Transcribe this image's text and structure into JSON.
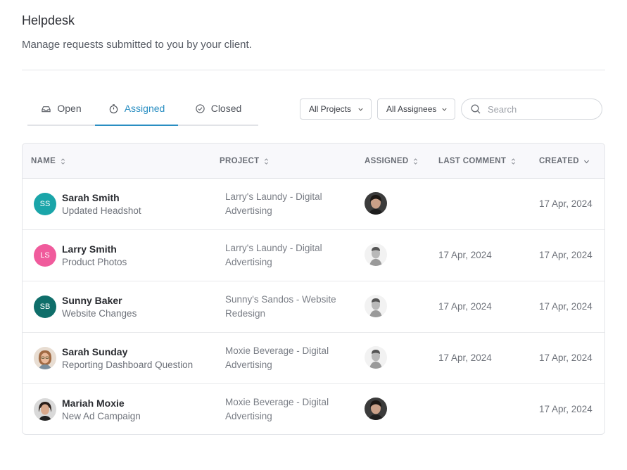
{
  "header": {
    "title": "Helpdesk",
    "subtitle": "Manage requests submitted to you by your client."
  },
  "tabs": [
    {
      "label": "Open",
      "icon": "inbox-icon",
      "active": false
    },
    {
      "label": "Assigned",
      "icon": "timer-icon",
      "active": true
    },
    {
      "label": "Closed",
      "icon": "check-circle-icon",
      "active": false
    }
  ],
  "filters": {
    "projects": "All Projects",
    "assignees": "All Assignees",
    "search_placeholder": "Search"
  },
  "columns": {
    "name": "NAME",
    "project": "PROJECT",
    "assigned": "ASSIGNED",
    "last_comment": "LAST COMMENT",
    "created": "CREATED"
  },
  "colors": {
    "accent": "#2a8ec2",
    "avatar_ss": "#1aa5a9",
    "avatar_ls": "#f05b9c",
    "avatar_sb": "#0f6e6a"
  },
  "rows": [
    {
      "initials": "SS",
      "name": "Sarah Smith",
      "request": "Updated Headshot",
      "project_line1": "Larry's Laundy - Digital",
      "project_line2": "Advertising",
      "assignee": "woman-avatar",
      "last_comment": "",
      "created": "17 Apr, 2024"
    },
    {
      "initials": "LS",
      "name": "Larry Smith",
      "request": "Product Photos",
      "project_line1": "Larry's Laundy - Digital",
      "project_line2": "Advertising",
      "assignee": "man-avatar",
      "last_comment": "17 Apr, 2024",
      "created": "17 Apr, 2024"
    },
    {
      "initials": "SB",
      "name": "Sunny Baker",
      "request": "Website Changes",
      "project_line1": "Sunny's Sandos - Website",
      "project_line2": "Redesign",
      "assignee": "man-avatar",
      "last_comment": "17 Apr, 2024",
      "created": "17 Apr, 2024"
    },
    {
      "initials": "",
      "name": "Sarah Sunday",
      "request": "Reporting Dashboard Question",
      "project_line1": "Moxie Beverage - Digital",
      "project_line2": "Advertising",
      "assignee": "man-avatar",
      "last_comment": "17 Apr, 2024",
      "created": "17 Apr, 2024"
    },
    {
      "initials": "",
      "name": "Mariah Moxie",
      "request": "New Ad Campaign",
      "project_line1": "Moxie Beverage - Digital",
      "project_line2": "Advertising",
      "assignee": "woman-avatar",
      "last_comment": "",
      "created": "17 Apr, 2024"
    }
  ]
}
